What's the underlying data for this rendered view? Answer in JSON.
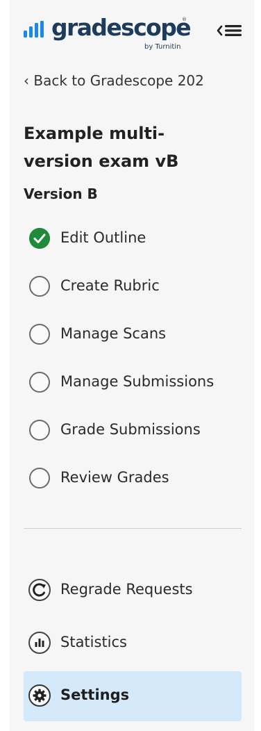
{
  "brand": {
    "name": "gradescope",
    "reg": "®",
    "tagline": "by Turnitin",
    "color": "#1d3b5a",
    "accent": "#1e88e5"
  },
  "header": {
    "collapse_icon": "collapse-sidebar-icon"
  },
  "back_link": "‹ Back to Gradescope 202",
  "assignment": {
    "title": "Example multi-version exam vB",
    "version": "Version B"
  },
  "steps": [
    {
      "label": "Edit Outline",
      "done": true
    },
    {
      "label": "Create Rubric",
      "done": false
    },
    {
      "label": "Manage Scans",
      "done": false
    },
    {
      "label": "Manage Submissions",
      "done": false
    },
    {
      "label": "Grade Submissions",
      "done": false
    },
    {
      "label": "Review Grades",
      "done": false
    }
  ],
  "nav": [
    {
      "label": "Regrade Requests",
      "icon": "regrade-icon",
      "active": false
    },
    {
      "label": "Statistics",
      "icon": "statistics-icon",
      "active": false
    },
    {
      "label": "Settings",
      "icon": "settings-gear-icon",
      "active": true
    }
  ],
  "colors": {
    "check_green": "#1f8a3b",
    "active_bg": "#d4eafb"
  }
}
